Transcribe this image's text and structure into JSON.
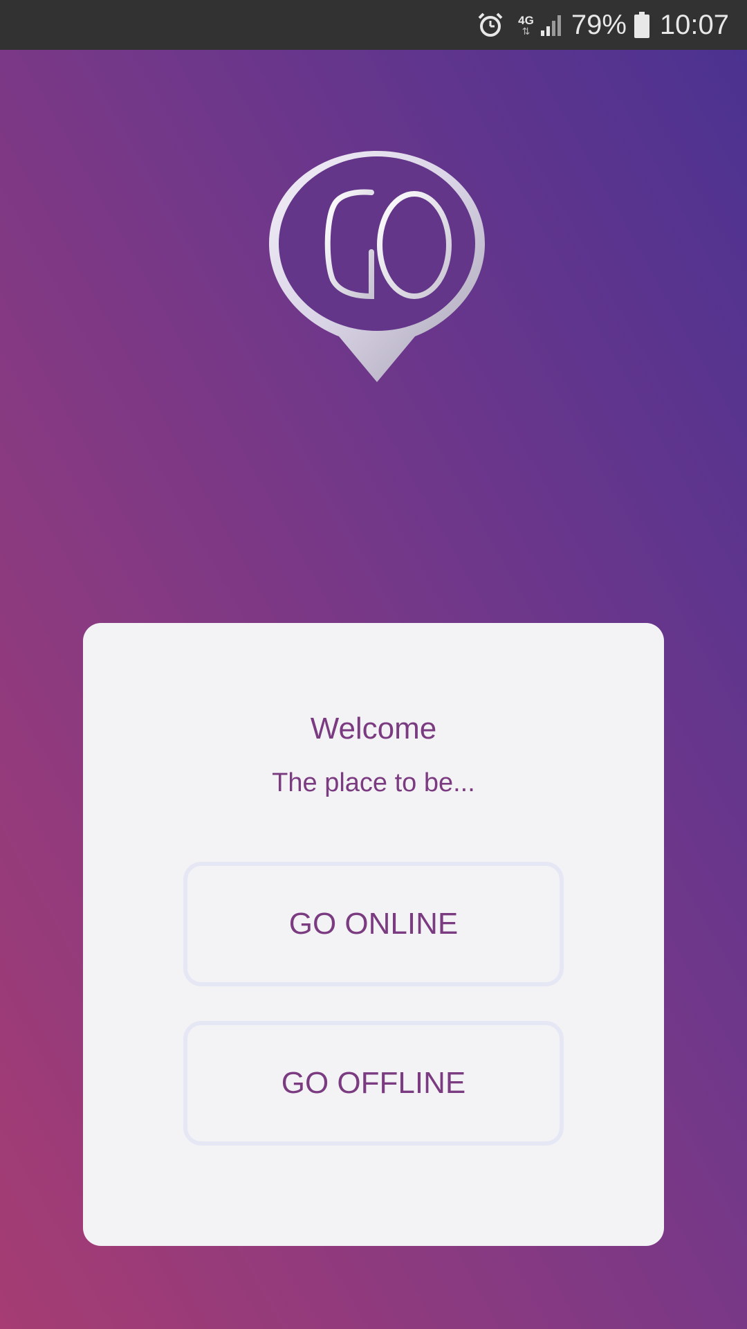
{
  "status_bar": {
    "alarm_icon": "alarm-clock-icon",
    "network_type": "4G",
    "network_arrows": "⇅",
    "signal_icon": "signal-strength-icon",
    "battery_percent": "79%",
    "battery_icon": "battery-icon",
    "time": "10:07"
  },
  "logo": {
    "icon": "go-location-pin-logo",
    "text": "GO"
  },
  "card": {
    "welcome": "Welcome",
    "tagline": "The place to be...",
    "online_button_label": "GO ONLINE",
    "offline_button_label": "GO OFFLINE"
  },
  "colors": {
    "accent_text": "#7a3b80",
    "card_background": "#f3f3f5",
    "button_border": "#e6e7f4",
    "status_bar": "#323232",
    "gradient_top": "#4a3291",
    "gradient_bottom": "#a63c73"
  }
}
